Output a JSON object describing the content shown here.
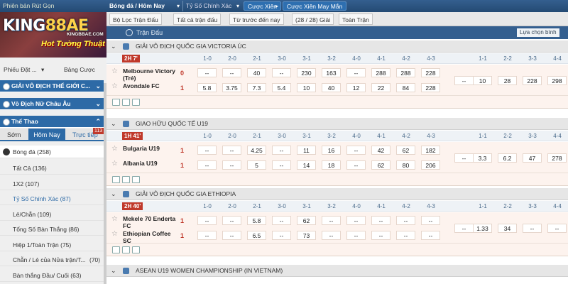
{
  "topbar": {
    "region": "Phiên bản Rút Gọn",
    "sport": "Bóng đá / Hôm Nay",
    "bettype": "Tỷ Số Chính Xác",
    "parlay1": "Cược Xiên",
    "parlay2": "Cược Xiên May Mắn"
  },
  "filters": {
    "league": "Bộ Lọc Trận Đấu",
    "all": "Tất cả trận đấu",
    "sort": "Từ trước đến nay",
    "count": "(28 / 28) Giải",
    "full": "Toàn Trận"
  },
  "banner": {
    "logo_a": "KING",
    "logo_b": "88AE",
    "small": "KINGBBAE.COM",
    "promo": "Hot Tường Thuật"
  },
  "sidebar": {
    "tab_slip": "Phiếu Đặt ...",
    "tab_bets": "Bảng Cược",
    "h1": "GIẢI VÔ ĐỊCH THẾ GIỚI C...",
    "h2": "Vô Địch Nữ Châu Âu",
    "h3": "Thể Thao",
    "tabs": [
      "Sớm",
      "Hôm Nay",
      "Trực tiếp"
    ],
    "live_count": "113",
    "sport": "Bóng đá",
    "sport_count": "(258)",
    "items": [
      {
        "label": "Tất Cả",
        "count": "(136)"
      },
      {
        "label": "1X2",
        "count": "(107)"
      },
      {
        "label": "Tỷ Số Chính Xác",
        "count": "(87)"
      },
      {
        "label": "Lẻ/Chẵn",
        "count": "(109)"
      },
      {
        "label": "Tổng Số Bàn Thắng",
        "count": "(86)"
      },
      {
        "label": "Hiệp 1/Toàn Trận",
        "count": "(75)"
      },
      {
        "label": "Chẵn / Lẻ của Nửa trận/T...",
        "count": "(70)"
      },
      {
        "label": "Bàn thắng Đầu/ Cuối",
        "count": "(63)"
      }
    ]
  },
  "main": {
    "header": "Trận Đấu",
    "select_btn": "Lựa chọn bình",
    "cols": [
      "1-0",
      "2-0",
      "2-1",
      "3-0",
      "3-1",
      "3-2",
      "4-0",
      "4-1",
      "4-2",
      "4-3",
      "",
      "1-1",
      "2-2",
      "3-3",
      "4-4"
    ],
    "leagues": [
      {
        "name": "GIẢI VÔ ĐỊCH QUỐC GIA VICTORIA ÚC",
        "time": "2H 7'",
        "home": "Melbourne Victory (Trẻ)",
        "away": "Avondale FC",
        "hs": "0",
        "as": "1",
        "home_odds": [
          "--",
          "--",
          "40",
          "--",
          "230",
          "163",
          "--",
          "288",
          "288",
          "228"
        ],
        "away_odds": [
          "5.8",
          "3.75",
          "7.3",
          "5.4",
          "10",
          "40",
          "12",
          "22",
          "84",
          "228"
        ],
        "draw_odds": [
          "--",
          "10",
          "28",
          "228",
          "298"
        ]
      },
      {
        "name": "GIAO HỮU QUỐC TẾ U19",
        "time": "1H 41'",
        "home": "Bulgaria U19",
        "away": "Albania U19",
        "hs": "1",
        "as": "1",
        "home_odds": [
          "--",
          "--",
          "4.25",
          "--",
          "11",
          "16",
          "--",
          "42",
          "62",
          "182"
        ],
        "away_odds": [
          "--",
          "--",
          "5",
          "--",
          "14",
          "18",
          "--",
          "62",
          "80",
          "206"
        ],
        "draw_odds": [
          "--",
          "3.3",
          "6.2",
          "47",
          "278"
        ]
      },
      {
        "name": "GIẢI VÔ ĐỊCH QUỐC GIA ETHIOPIA",
        "time": "2H 40'",
        "home": "Mekele 70 Enderta FC",
        "away": "Ethiopian Coffee SC",
        "hs": "1",
        "as": "1",
        "home_odds": [
          "--",
          "--",
          "5.8",
          "--",
          "62",
          "--",
          "--",
          "--",
          "--",
          "--"
        ],
        "away_odds": [
          "--",
          "--",
          "6.5",
          "--",
          "73",
          "--",
          "--",
          "--",
          "--",
          "--"
        ],
        "draw_odds": [
          "--",
          "1.33",
          "34",
          "--",
          "--"
        ]
      },
      {
        "name": "ASEAN U19 WOMEN CHAMPIONSHIP (IN VIETNAM)"
      }
    ]
  }
}
